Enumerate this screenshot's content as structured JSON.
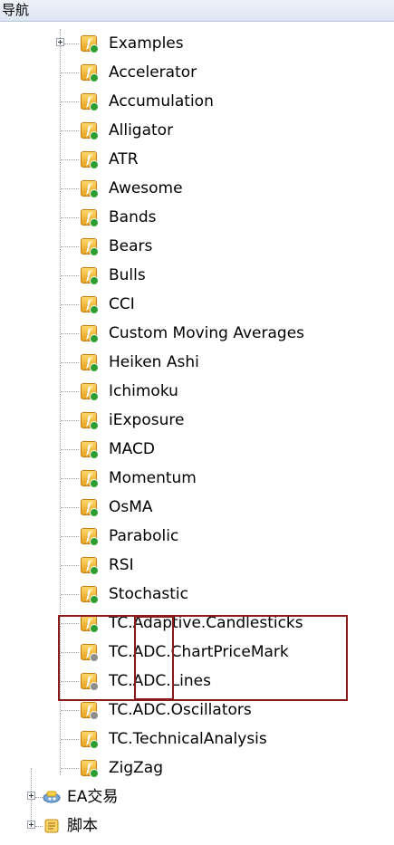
{
  "header": {
    "title": "导航"
  },
  "tree": {
    "examples_label": "Examples",
    "indicators": [
      "Accelerator",
      "Accumulation",
      "Alligator",
      "ATR",
      "Awesome",
      "Bands",
      "Bears",
      "Bulls",
      "CCI",
      "Custom Moving Averages",
      "Heiken Ashi",
      "Ichimoku",
      "iExposure",
      "MACD",
      "Momentum",
      "OsMA",
      "Parabolic",
      "RSI",
      "Stochastic",
      "TC.Adaptive.Candlesticks",
      "TC.ADC.ChartPriceMark",
      "TC.ADC.Lines",
      "TC.ADC.Oscillators",
      "TC.TechnicalAnalysis",
      "ZigZag"
    ],
    "ea_label": "EA交易",
    "scripts_label": "脚本"
  },
  "colors": {
    "highlight": "#8b1a1a",
    "icon": "#e8a21d",
    "header": "#dbe4f1"
  },
  "icons": {
    "indicator": "f-indicator-icon",
    "ea": "robot-icon",
    "script": "scroll-icon"
  }
}
